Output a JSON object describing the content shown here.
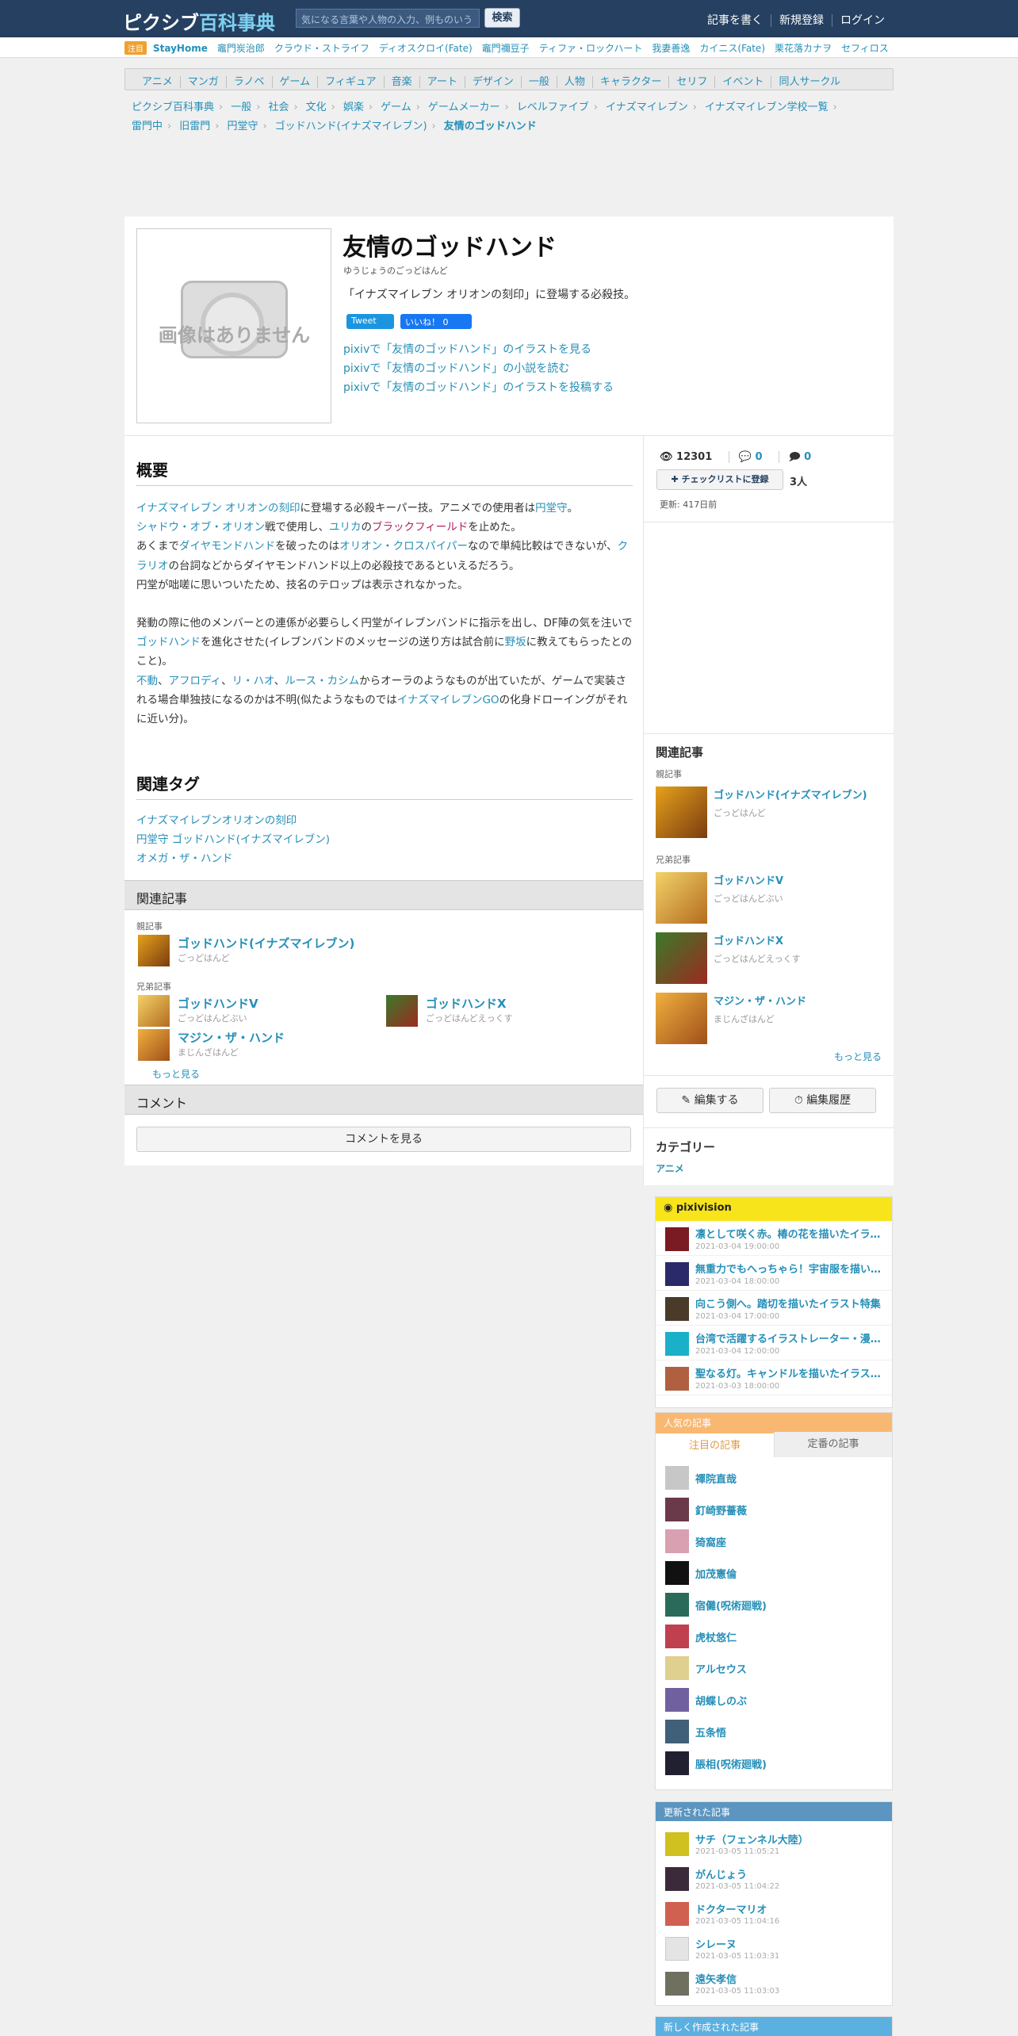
{
  "header": {
    "logo_main": "ピクシブ",
    "logo_accent": "百科事典",
    "search_placeholder": "気になる言葉や人物の入力、例ものいう",
    "search_button": "検索",
    "nav": [
      "記事を書く",
      "新規登録",
      "ログイン"
    ]
  },
  "trend": {
    "badge": "注目",
    "items": [
      "StayHome",
      "竈門炭治郎",
      "クラウド・ストライフ",
      "ディオスクロイ(Fate)",
      "竈門禰豆子",
      "ティファ・ロックハート",
      "我妻善逸",
      "カイニス(Fate)",
      "栗花落カナヲ",
      "セフィロス"
    ]
  },
  "categories": [
    "アニメ",
    "マンガ",
    "ラノベ",
    "ゲーム",
    "フィギュア",
    "音楽",
    "アート",
    "デザイン",
    "一般",
    "人物",
    "キャラクター",
    "セリフ",
    "イベント",
    "同人サークル"
  ],
  "breadcrumb": [
    "ピクシブ百科事典",
    "一般",
    "社会",
    "文化",
    "娯楽",
    "ゲーム",
    "ゲームメーカー",
    "レベルファイブ",
    "イナズマイレブン",
    "イナズマイレブン学校一覧",
    "雷門中",
    "旧雷門",
    "円堂守",
    "ゴッドハンド(イナズマイレブン)"
  ],
  "breadcrumb_current": "友情のゴッドハンド",
  "hero": {
    "no_image": "画像はありません",
    "title": "友情のゴッドハンド",
    "reading": "ゆうじょうのごっどはんど",
    "description": "「イナズマイレブン オリオンの刻印」に登場する必殺技。",
    "tweet": "Tweet",
    "like": "いいね！ 0",
    "links": [
      "pixivで「友情のゴッドハンド」のイラストを見る",
      "pixivで「友情のゴッドハンド」の小説を読む",
      "pixivで「友情のゴッドハンド」のイラストを投稿する"
    ]
  },
  "summary": {
    "heading": "概要",
    "p1": [
      [
        "イナズマイレブン オリオンの刻印",
        "link"
      ],
      [
        "に登場する必殺キーパー技。アニメでの使用者は",
        ""
      ],
      [
        "円堂守",
        "link"
      ],
      [
        "。",
        ""
      ],
      [
        "\n",
        ""
      ],
      [
        "シャドウ・オブ・オリオン",
        "link"
      ],
      [
        "戦で使用し、",
        ""
      ],
      [
        "ユリカ",
        "link"
      ],
      [
        "の",
        ""
      ],
      [
        "ブラックフィールド",
        "red"
      ],
      [
        "を止めた。",
        ""
      ],
      [
        "\n",
        ""
      ],
      [
        "あくまで",
        ""
      ],
      [
        "ダイヤモンドハンド",
        "link"
      ],
      [
        "を破ったのは",
        ""
      ],
      [
        "オリオン・クロスパイパー",
        "link"
      ],
      [
        "なので単純比較はできないが、",
        ""
      ],
      [
        "クラリオ",
        "link"
      ],
      [
        "の台詞などからダイヤモンドハンド以上の必殺技であるといえるだろう。",
        ""
      ],
      [
        "\n",
        ""
      ],
      [
        "円堂が咄嗟に思いついたため、技名のテロップは表示されなかった。",
        ""
      ]
    ],
    "p2": [
      [
        "発動の際に他のメンバーとの連係が必要らしく円堂がイレブンバンドに指示を出し、DF陣の気を注いで",
        ""
      ],
      [
        "ゴッドハンド",
        "link"
      ],
      [
        "を進化させた(イレブンバンドのメッセージの送り方は試合前に",
        ""
      ],
      [
        "野坂",
        "link"
      ],
      [
        "に教えてもらったとのこと)。",
        ""
      ],
      [
        "\n",
        ""
      ],
      [
        "不動",
        "link"
      ],
      [
        "、",
        ""
      ],
      [
        "アフロディ",
        "link"
      ],
      [
        "、",
        ""
      ],
      [
        "リ・ハオ",
        "link"
      ],
      [
        "、",
        ""
      ],
      [
        "ルース・カシム",
        "link"
      ],
      [
        "からオーラのようなものが出ていたが、ゲームで実装される場合単独技になるのかは不明(似たようなものでは",
        ""
      ],
      [
        "イナズマイレブンGO",
        "link"
      ],
      [
        "の化身ドローイングがそれに近い分)。",
        ""
      ]
    ]
  },
  "tags": {
    "heading": "関連タグ",
    "items": [
      "イナズマイレブンオリオンの刻印",
      "円堂守 ゴッドハンド(イナズマイレブン)",
      "オメガ・ザ・ハンド"
    ]
  },
  "related": {
    "heading": "関連記事",
    "parent_label": "親記事",
    "sibling_label": "兄弟記事",
    "parent": {
      "title": "ゴッドハンド(イナズマイレブン)",
      "reading": "ごっどはんど"
    },
    "siblings": [
      {
        "title": "ゴッドハンドV",
        "reading": "ごっどはんどぶい"
      },
      {
        "title": "ゴッドハンドX",
        "reading": "ごっどはんどえっくす"
      },
      {
        "title": "マジン・ザ・ハンド",
        "reading": "まじんざはんど"
      }
    ],
    "more": "もっと見る"
  },
  "comments": {
    "heading": "コメント",
    "button": "コメントを見る"
  },
  "stats": {
    "views": "12301",
    "comments": "0",
    "bubbles": "0",
    "checklist_button": "チェックリストに登録",
    "checklist_count": "3人",
    "updated": "更新: 417日前"
  },
  "side_related": {
    "heading": "関連記事",
    "more": "もっと見る"
  },
  "edit": {
    "edit_button": "編集する",
    "history_button": "編集履歴"
  },
  "category": {
    "heading": "カテゴリー",
    "value": "アニメ"
  },
  "pixivision": {
    "title": "pixivision",
    "items": [
      {
        "title": "凛として咲く赤。椿の花を描いたイラスト特集",
        "date": "2021-03-04 19:00:00"
      },
      {
        "title": "無重力でもへっちゃら！宇宙服を描いたイラスト特集",
        "date": "2021-03-04 18:00:00"
      },
      {
        "title": "向こう側へ。踏切を描いたイラスト特集",
        "date": "2021-03-04 17:00:00"
      },
      {
        "title": "台湾で活躍するイラストレーター・漫画家特集",
        "date": "2021-03-04 12:00:00"
      },
      {
        "title": "聖なる灯。キャンドルを描いたイラスト特集",
        "date": "2021-03-03 18:00:00"
      }
    ]
  },
  "popular": {
    "title": "人気の記事",
    "tab_hot": "注目の記事",
    "tab_std": "定番の記事",
    "items": [
      "禪院直哉",
      "釘崎野薔薇",
      "猗窩座",
      "加茂憲倫",
      "宿儺(呪術廻戦)",
      "虎杖悠仁",
      "アルセウス",
      "胡蝶しのぶ",
      "五条悟",
      "脹相(呪術廻戦)"
    ]
  },
  "updated": {
    "title": "更新された記事",
    "items": [
      {
        "title": "サチ（フェンネル大陸）",
        "date": "2021-03-05 11:05:21"
      },
      {
        "title": "がんじょう",
        "date": "2021-03-05 11:04:22"
      },
      {
        "title": "ドクターマリオ",
        "date": "2021-03-05 11:04:16"
      },
      {
        "title": "シレーヌ",
        "date": "2021-03-05 11:03:31"
      },
      {
        "title": "遠矢孝信",
        "date": "2021-03-05 11:03:03"
      }
    ]
  },
  "new_articles": {
    "title": "新しく作成された記事"
  },
  "colors": {
    "header_bg": "#264061",
    "link": "#258fb8",
    "pixivision": "#f7e41b",
    "popular": "#f9b872",
    "updated": "#5b95c0"
  }
}
